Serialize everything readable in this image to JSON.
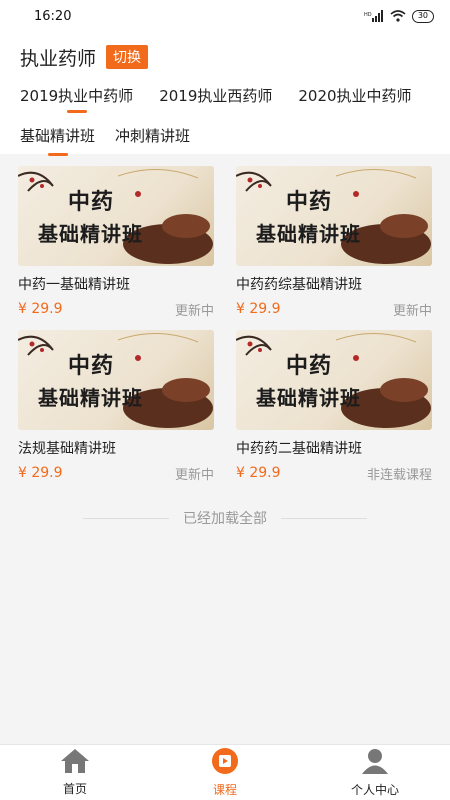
{
  "status_bar": {
    "time": "16:20",
    "battery": "30"
  },
  "header": {
    "title": "执业药师",
    "switch_label": "切换",
    "level1_tabs": [
      {
        "label": "2019执业中药师",
        "active": true
      },
      {
        "label": "2019执业西药师",
        "active": false
      },
      {
        "label": "2020执业中药师",
        "active": false
      }
    ],
    "level2_tabs": [
      {
        "label": "基础精讲班",
        "active": true
      },
      {
        "label": "冲刺精讲班",
        "active": false
      }
    ]
  },
  "courses": [
    {
      "thumb_line1": "中药",
      "thumb_line2": "基础精讲班",
      "title": "中药一基础精讲班",
      "price": "¥ 29.9",
      "status": "更新中"
    },
    {
      "thumb_line1": "中药",
      "thumb_line2": "基础精讲班",
      "title": "中药药综基础精讲班",
      "price": "¥ 29.9",
      "status": "更新中"
    },
    {
      "thumb_line1": "中药",
      "thumb_line2": "基础精讲班",
      "title": "法规基础精讲班",
      "price": "¥ 29.9",
      "status": "更新中"
    },
    {
      "thumb_line1": "中药",
      "thumb_line2": "基础精讲班",
      "title": "中药药二基础精讲班",
      "price": "¥ 29.9",
      "status": "非连载课程"
    }
  ],
  "footer_text": "已经加载全部",
  "bottom_nav": [
    {
      "label": "首页",
      "icon": "home-icon",
      "active": false
    },
    {
      "label": "课程",
      "icon": "course-play-icon",
      "active": true
    },
    {
      "label": "个人中心",
      "icon": "person-icon",
      "active": false
    }
  ],
  "colors": {
    "accent": "#f26a1b",
    "muted": "#999999",
    "background": "#f4f4f4"
  }
}
